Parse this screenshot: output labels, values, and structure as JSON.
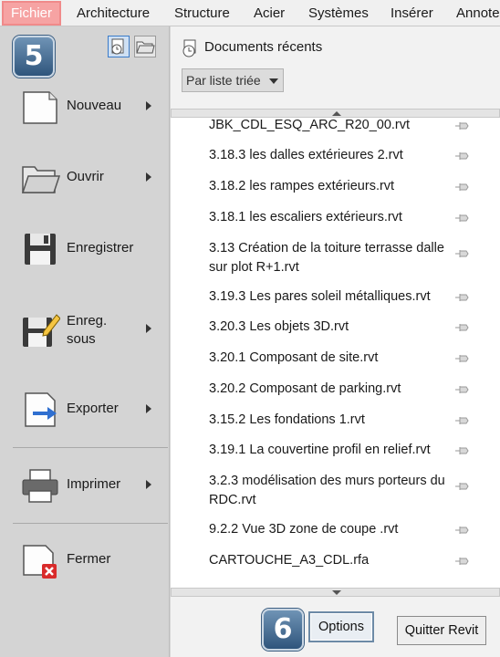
{
  "ribbon": {
    "tabs": [
      {
        "label": "Fichier"
      },
      {
        "label": "Architecture"
      },
      {
        "label": "Structure"
      },
      {
        "label": "Acier"
      },
      {
        "label": "Systèmes"
      },
      {
        "label": "Insérer"
      },
      {
        "label": "Annote"
      }
    ]
  },
  "badges": {
    "step5": "5",
    "step6": "6"
  },
  "menu": {
    "items": [
      {
        "label": "Nouveau",
        "icon": "new-document-icon"
      },
      {
        "label": "Ouvrir",
        "icon": "folder-open-icon"
      },
      {
        "label": "Enregistrer",
        "icon": "floppy-disk-icon"
      },
      {
        "label": "Enreg. sous",
        "icon": "save-as-icon"
      },
      {
        "label": "Exporter",
        "icon": "export-icon"
      },
      {
        "label": "Imprimer",
        "icon": "printer-icon"
      },
      {
        "label": "Fermer",
        "icon": "close-document-icon"
      }
    ]
  },
  "recent": {
    "title": "Documents récents",
    "sort_label": "Par liste triée",
    "files": [
      "JBK_CDL_ESQ_ARC_R20_00.rvt",
      "3.18.3 les dalles extérieures 2.rvt",
      "3.18.2 les rampes extérieurs.rvt",
      "3.18.1 les escaliers extérieurs.rvt",
      "3.13 Création de la toiture terrasse dalle sur plot R+1.rvt",
      "3.19.3 Les pares soleil métalliques.rvt",
      "3.20.3 Les objets 3D.rvt",
      "3.20.1 Composant de site.rvt",
      "3.20.2 Composant de parking.rvt",
      "3.15.2 Les fondations 1.rvt",
      "3.19.1 La couvertine profil en relief.rvt",
      "3.2.3 modélisation des murs porteurs du RDC.rvt",
      "9.2.2 Vue 3D zone de coupe .rvt",
      "CARTOUCHE_A3_CDL.rfa"
    ]
  },
  "buttons": {
    "options": "Options",
    "quit": "Quitter Revit"
  },
  "colors": {
    "active_tab": "#f6a3a3",
    "badge": "#3d6690",
    "panel": "#d4d4d4"
  }
}
